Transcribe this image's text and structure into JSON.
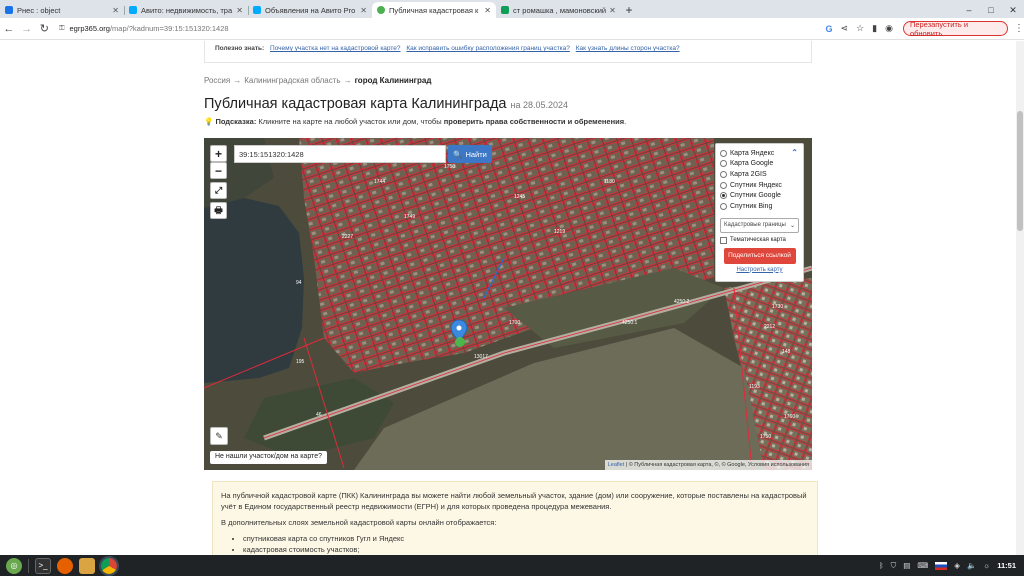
{
  "tabs": [
    {
      "title": "Рнес : object",
      "color": "#1a73e8"
    },
    {
      "title": "Авито: недвижимость, тра",
      "color": "#00aaff"
    },
    {
      "title": "Объявления на Авито Pro",
      "color": "#00aaff"
    },
    {
      "title": "Публичная кадастровая к",
      "color": "#4caf50",
      "active": true
    },
    {
      "title": "ст ромашка , мамоновский",
      "color": "#0f9d58"
    }
  ],
  "new_tab_symbol": "+",
  "window_controls": {
    "minimize": "–",
    "maximize": "□",
    "close": "✕"
  },
  "address": {
    "host": "egrp365.org",
    "path": "/map/?kadnum=39:15:151320:1428"
  },
  "relaunch_label": "Перезапустить и обновить",
  "useful": {
    "label": "Полезно знать:",
    "links": [
      "Почему участка нет на кадастровой карте?",
      "Как исправить ошибку расположения границ участка?",
      "Как узнать длины сторон участка?"
    ]
  },
  "breadcrumbs": {
    "items": [
      "Россия",
      "Калининградская область"
    ],
    "current": "город Калининград",
    "sep": "→"
  },
  "title": {
    "main": "Публичная кадастровая карта Калининграда",
    "date": "на 28.05.2024"
  },
  "hint": {
    "label": "Подсказка:",
    "text": "Кликните на карте на любой участок или дом, чтобы",
    "bold": "проверить права собственности и обременения",
    "end": "."
  },
  "map": {
    "search_value": "39:15:151320:1428",
    "find_label": "Найти",
    "zoom_in": "+",
    "zoom_out": "−",
    "layers": [
      {
        "label": "Карта Яндекс",
        "checked": false
      },
      {
        "label": "Карта Google",
        "checked": false
      },
      {
        "label": "Карта 2GIS",
        "checked": false
      },
      {
        "label": "Спутник Яндекс",
        "checked": false
      },
      {
        "label": "Спутник Google",
        "checked": true
      },
      {
        "label": "Спутник Bing",
        "checked": false
      }
    ],
    "overlay_select": "Кадастровые границы",
    "thematic_label": "Тематическая карта",
    "share_label": "Поделиться ссылкой",
    "configure_label": "Настроить карту",
    "not_found_label": "Не нашли участок/дом на карте?",
    "attribution": {
      "leaflet": "Leaflet",
      "rest": "| © Публичная кадастровая карта, ©, © Google, Условия использования"
    },
    "parcel_labels": [
      "94",
      "195",
      "46",
      "4250:2",
      "4250:1",
      "13017",
      "1700",
      "2227",
      "1744",
      "1749",
      "1750",
      "1245",
      "1219",
      "1180",
      "2212",
      "1193",
      "148",
      "1760",
      "1730",
      "1750"
    ]
  },
  "info": {
    "p1": "На публичной кадастровой карте (ПКК) Калининграда вы можете найти любой земельный участок, здание (дом) или сооружение, которые поставлены на кадастровый учёт в Едином государственный реестр недвижимости (ЕГРН) и для которых проведена процедура межевания.",
    "p2": "В дополнительных слоях земельной кадастровой карты онлайн отображается:",
    "items": [
      "спутниковая карта со спутников Гугл и Яндекс",
      "кадастровая стоимость участков;"
    ]
  },
  "taskbar": {
    "clock": "11:51"
  }
}
